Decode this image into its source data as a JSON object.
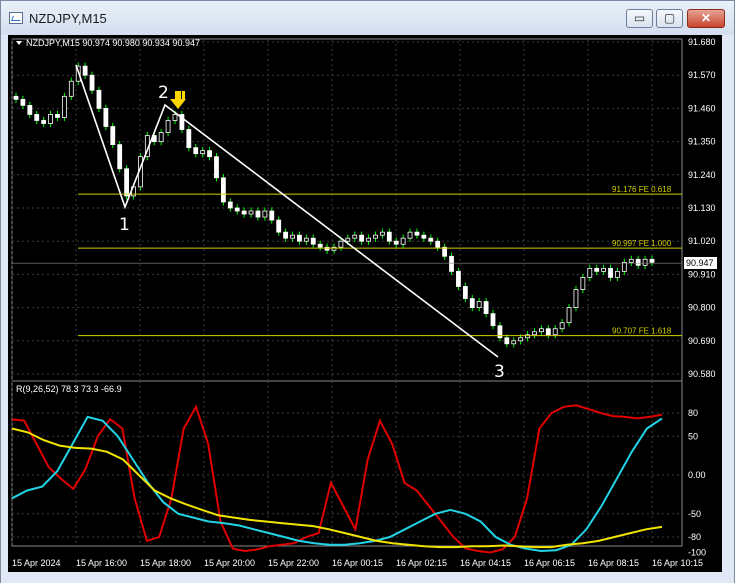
{
  "window": {
    "title": "NZDJPY,M15",
    "icon": "chart-window-icon",
    "buttons": {
      "minimize": "▭",
      "maximize": "▢",
      "close": "✕"
    }
  },
  "price_chart": {
    "info_label": "NZDJPY,M15  90.974 90.980 90.934 90.947",
    "price_axis_ticks": [
      "91.680",
      "91.570",
      "91.460",
      "91.350",
      "91.240",
      "91.130",
      "91.020",
      "90.910",
      "90.800",
      "90.690",
      "90.580"
    ],
    "current_price": "90.947",
    "fib_levels": [
      {
        "label": "91.176 FE 0.618",
        "price": 91.176
      },
      {
        "label": "90.997 FE 1.000",
        "price": 90.997
      },
      {
        "label": "90.707 FE 1.618",
        "price": 90.707
      }
    ],
    "pattern_points": [
      "1",
      "2",
      "3"
    ],
    "arrow": "down-arrow",
    "colors": {
      "bull": "#ffffff",
      "bear": "#ffffff",
      "wick": "#00ff00",
      "fib": "#d4d000",
      "pattern": "#ffffff",
      "arrow": "#ffd700",
      "grid": "#4a4a4a"
    }
  },
  "indicator": {
    "label": "R(9,26,52) 78.3 73.3 -66.9",
    "axis_ticks": [
      "80",
      "50",
      "0.00",
      "-50",
      "-80",
      "-100"
    ],
    "colors": {
      "fast": "#e00000",
      "mid": "#22d3e6",
      "slow": "#f2e400"
    }
  },
  "time_axis": [
    "15 Apr 2024",
    "15 Apr 16:00",
    "15 Apr 18:00",
    "15 Apr 20:00",
    "15 Apr 22:00",
    "16 Apr 00:15",
    "16 Apr 02:15",
    "16 Apr 04:15",
    "16 Apr 06:15",
    "16 Apr 08:15",
    "16 Apr 10:15"
  ]
}
